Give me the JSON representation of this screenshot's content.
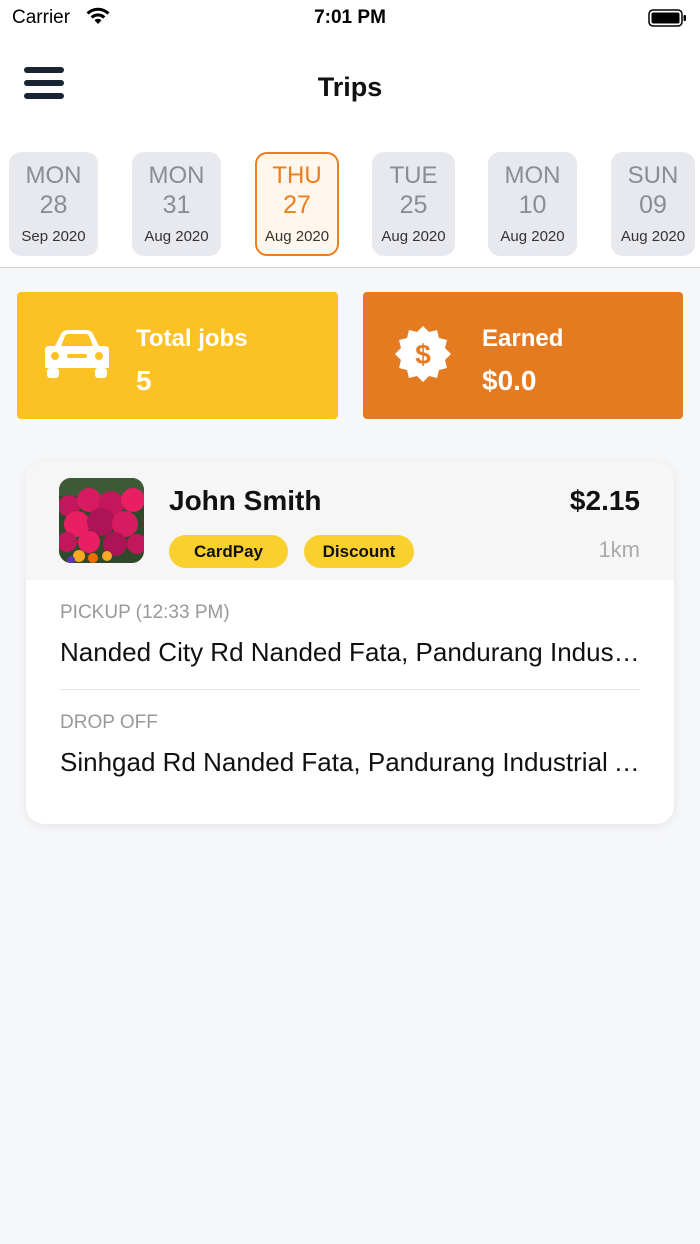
{
  "status_bar": {
    "carrier": "Carrier",
    "time": "7:01 PM"
  },
  "header": {
    "title": "Trips",
    "menu_icon": "hamburger-menu-icon"
  },
  "dates": [
    {
      "day": "MON",
      "num": "28",
      "month": "Sep 2020",
      "selected": false
    },
    {
      "day": "MON",
      "num": "31",
      "month": "Aug 2020",
      "selected": false
    },
    {
      "day": "THU",
      "num": "27",
      "month": "Aug 2020",
      "selected": true
    },
    {
      "day": "TUE",
      "num": "25",
      "month": "Aug 2020",
      "selected": false
    },
    {
      "day": "MON",
      "num": "10",
      "month": "Aug 2020",
      "selected": false
    },
    {
      "day": "SUN",
      "num": "09",
      "month": "Aug 2020",
      "selected": false
    }
  ],
  "stats": {
    "jobs": {
      "label": "Total jobs",
      "value": "5",
      "icon": "car-icon",
      "color": "#fcc122"
    },
    "earned": {
      "label": "Earned",
      "value": "$0.0",
      "icon": "dollar-badge-icon",
      "color": "#e47b21"
    }
  },
  "trip": {
    "rider_name": "John Smith",
    "price": "$2.15",
    "distance": "1km",
    "badges": [
      "CardPay",
      "Discount"
    ],
    "pickup_label": "PICKUP (12:33 PM)",
    "pickup_address": "Nanded City Rd Nanded Fata, Pandurang Industrial Area",
    "dropoff_label": "DROP OFF",
    "dropoff_address": "Sinhgad Rd Nanded Fata, Pandurang Industrial Area"
  },
  "colors": {
    "accent": "#ef7d1a",
    "badge": "#f9d02e"
  }
}
